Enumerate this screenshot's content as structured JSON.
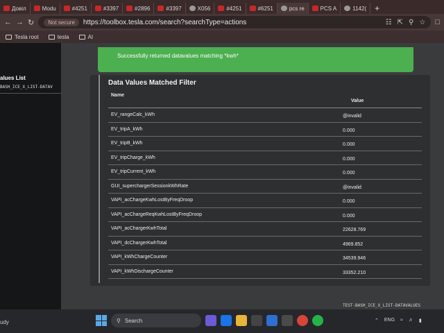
{
  "tabs": [
    {
      "label": "Довіл",
      "icon": "tesla-icon"
    },
    {
      "label": "Modu",
      "icon": "tesla-icon"
    },
    {
      "label": "#4251",
      "icon": "tesla-icon"
    },
    {
      "label": "#3397",
      "icon": "tesla-icon"
    },
    {
      "label": "#2896",
      "icon": "tesla-icon"
    },
    {
      "label": "#3397",
      "icon": "tesla-icon"
    },
    {
      "label": "X056",
      "icon": "globe-icon"
    },
    {
      "label": "#4251",
      "icon": "tesla-icon"
    },
    {
      "label": "#6251",
      "icon": "tesla-icon"
    },
    {
      "label": "pcs re",
      "icon": "chrome-icon"
    },
    {
      "label": "PCS A",
      "icon": "tesla-icon"
    },
    {
      "label": "1142(",
      "icon": "chrome-icon"
    }
  ],
  "new_tab_label": "+",
  "address": {
    "security_label": "Not secure",
    "url": "https://toolbox.tesla.com/search?searchType=actions"
  },
  "bookmarks": [
    "Tesla root",
    "tesla",
    "AI"
  ],
  "left_panel": {
    "title": "alues List",
    "subtitle": "BASH_ICE_X_LIST-DATAV"
  },
  "success_message": "Successfully returned datavalues matching *kwh*",
  "card": {
    "title": "Data Values Matched Filter",
    "col_name": "Name",
    "col_value": "Value"
  },
  "rows": [
    {
      "name": "EV_rangeCalc_kWh",
      "value": "@invalid"
    },
    {
      "name": "EV_tripA_kWh",
      "value": "0.000"
    },
    {
      "name": "EV_tripB_kWh",
      "value": "0.000"
    },
    {
      "name": "EV_tripCharge_kWh",
      "value": "0.000"
    },
    {
      "name": "EV_tripCurrent_kWh",
      "value": "0.000"
    },
    {
      "name": "GUI_superchargerSessionkWhRate",
      "value": "@invalid"
    },
    {
      "name": "VAPI_acChargeKwhLostByFreqDroop",
      "value": "0.000"
    },
    {
      "name": "VAPI_acChargeReqKwhLostByFreqDroop",
      "value": "0.000"
    },
    {
      "name": "VAPI_acChargerKwhTotal",
      "value": "22628.769"
    },
    {
      "name": "VAPI_dcChargerKwhTotal",
      "value": "4969.852"
    },
    {
      "name": "VAPI_kWhChargeCounter",
      "value": "34539.946"
    },
    {
      "name": "VAPI_kWhDischargeCounter",
      "value": "33352.210"
    }
  ],
  "footer_code": "TEST-BASH_ICE_X_LIST-DATAVALUES",
  "taskbar": {
    "weather": "udy",
    "search_label": "Search",
    "language": "ENG"
  }
}
